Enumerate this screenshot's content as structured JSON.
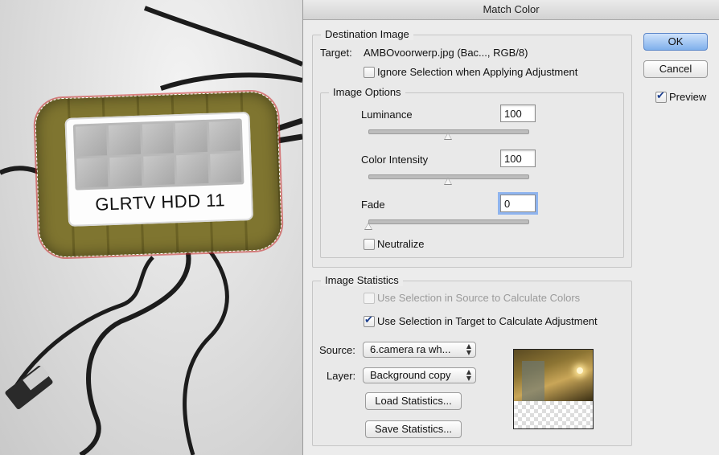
{
  "photo": {
    "hdd_label": "GLRTV HDD 11"
  },
  "dialog": {
    "title": "Match Color",
    "buttons": {
      "ok": "OK",
      "cancel": "Cancel"
    },
    "preview": {
      "label": "Preview",
      "checked": true
    },
    "destination": {
      "legend": "Destination Image",
      "target_label": "Target:",
      "target_value": "AMBOvoorwerp.jpg (Bac..., RGB/8)",
      "ignore_selection_label": "Ignore Selection when Applying Adjustment",
      "ignore_selection_checked": false,
      "image_options": {
        "legend": "Image Options",
        "luminance": {
          "label": "Luminance",
          "value": "100",
          "slider_fraction": 0.5
        },
        "color_intensity": {
          "label": "Color Intensity",
          "value": "100",
          "slider_fraction": 0.5
        },
        "fade": {
          "label": "Fade",
          "value": "0",
          "slider_fraction": 0.0
        },
        "neutralize_label": "Neutralize",
        "neutralize_checked": false
      }
    },
    "statistics": {
      "legend": "Image Statistics",
      "use_source_label": "Use Selection in Source to Calculate Colors",
      "use_source_checked": false,
      "use_target_label": "Use Selection in Target to Calculate Adjustment",
      "use_target_checked": true,
      "source_label": "Source:",
      "source_value": "6.camera ra wh...",
      "layer_label": "Layer:",
      "layer_value": "Background copy",
      "load_button": "Load Statistics...",
      "save_button": "Save Statistics..."
    }
  }
}
